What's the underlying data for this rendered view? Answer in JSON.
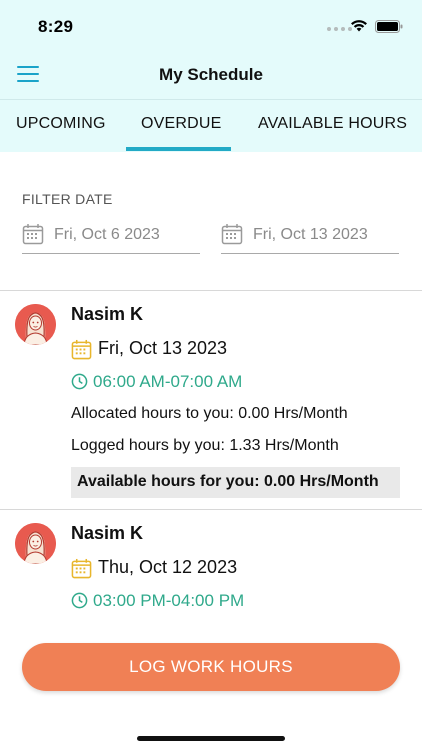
{
  "status_bar": {
    "time": "8:29"
  },
  "header": {
    "title": "My Schedule"
  },
  "tabs": [
    {
      "label": "UPCOMING"
    },
    {
      "label": "OVERDUE"
    },
    {
      "label": "AVAILABLE HOURS"
    }
  ],
  "active_tab": "OVERDUE",
  "filter": {
    "label": "FILTER DATE",
    "from_date": "Fri, Oct 6 2023",
    "to_date": "Fri, Oct 13 2023"
  },
  "schedules": [
    {
      "name": "Nasim K",
      "date": "Fri, Oct 13 2023",
      "time": "06:00 AM-07:00 AM",
      "allocated": "Allocated hours to you: 0.00 Hrs/Month",
      "logged": "Logged hours by you: 1.33 Hrs/Month",
      "available": "Available hours for you: 0.00 Hrs/Month"
    },
    {
      "name": "Nasim K",
      "date": "Thu, Oct 12 2023",
      "time": "03:00 PM-04:00 PM"
    }
  ],
  "actions": {
    "log_work_hours": "LOG WORK HOURS"
  },
  "colors": {
    "header_bg": "#e4fbfb",
    "accent": "#23aac6",
    "time_green": "#2fa98b",
    "button": "#f08055",
    "calendar_icon": "#e8b62c"
  },
  "icons": [
    "menu-icon",
    "calendar-icon",
    "clock-icon",
    "avatar",
    "wifi-icon",
    "battery-icon"
  ]
}
